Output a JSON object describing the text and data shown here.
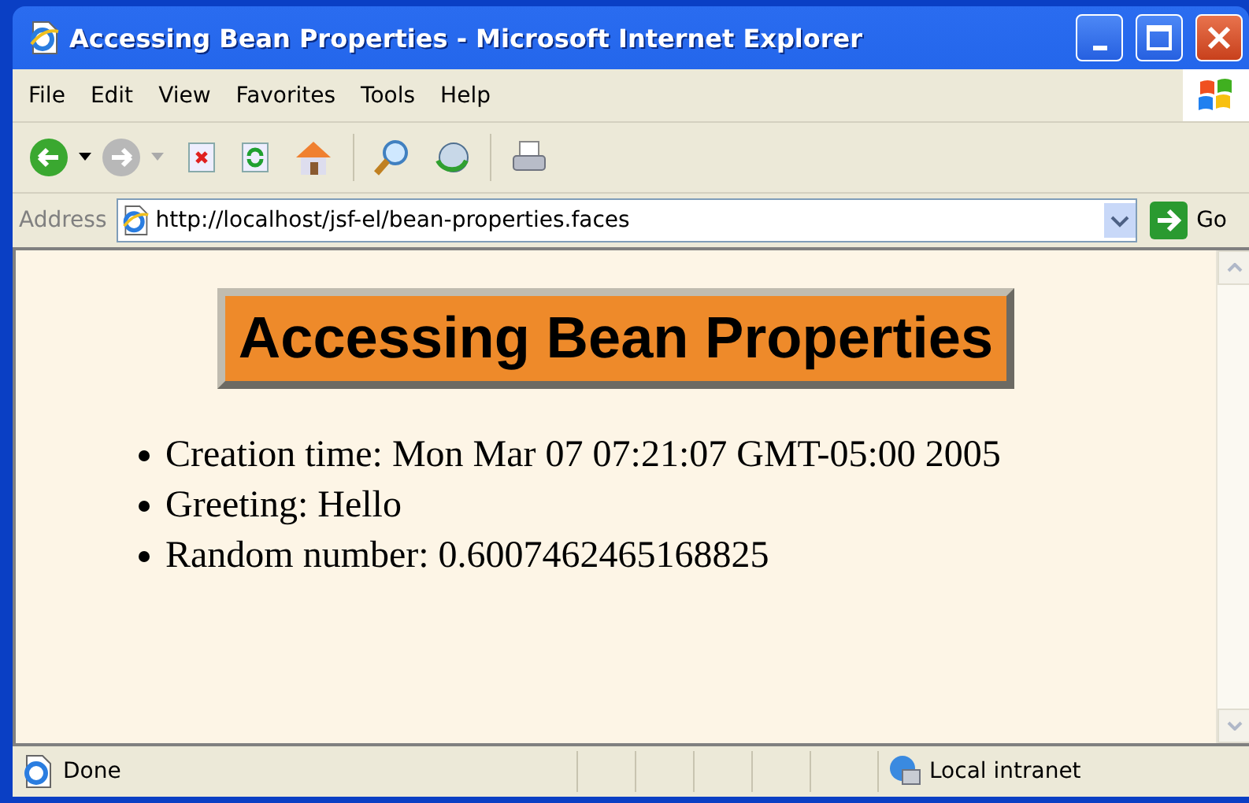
{
  "window": {
    "title": "Accessing Bean Properties - Microsoft Internet Explorer"
  },
  "menu": [
    "File",
    "Edit",
    "View",
    "Favorites",
    "Tools",
    "Help"
  ],
  "address_bar": {
    "label": "Address",
    "value": "http://localhost/jsf-el/bean-properties.faces",
    "go": "Go"
  },
  "page": {
    "heading": "Accessing Bean Properties",
    "items": [
      "Creation time: Mon Mar 07 07:21:07 GMT-05:00 2005",
      "Greeting: Hello",
      "Random number: 0.6007462465168825"
    ]
  },
  "status_bar": {
    "text": "Done",
    "zone": "Local intranet"
  }
}
